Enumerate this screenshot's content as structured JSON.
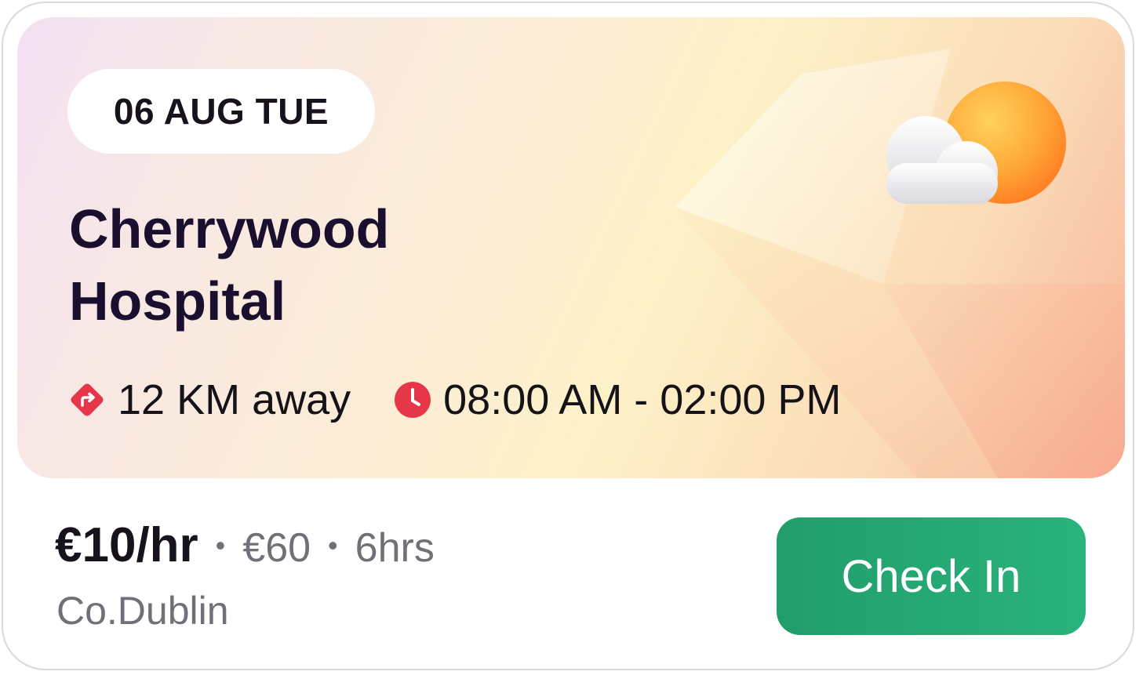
{
  "shift": {
    "date_label": "06 AUG TUE",
    "title_line1": "Cherrywood",
    "title_line2": "Hospital",
    "distance": "12 KM away",
    "time_range": "08:00 AM - 02:00 PM",
    "weather_icon": "partly-cloudy-icon"
  },
  "pay": {
    "rate": "€10/hr",
    "separator": "•",
    "total": "€60",
    "hours": "6hrs",
    "location": "Co.Dublin"
  },
  "actions": {
    "check_in_label": "Check In"
  },
  "colors": {
    "accent_red": "#e5364a",
    "check_in_green": "#27ad77",
    "title_text": "#1a0f2e",
    "muted_text": "#707078"
  },
  "icons": {
    "distance": "directions-icon",
    "time": "clock-icon"
  }
}
